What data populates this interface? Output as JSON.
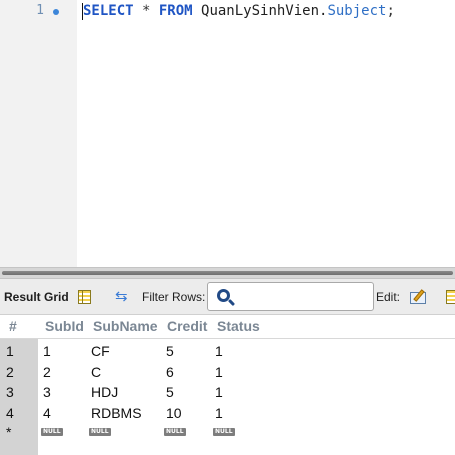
{
  "editor": {
    "line_number": "1",
    "code": {
      "kw_select": "SELECT",
      "op_star": " * ",
      "kw_from": "FROM",
      "object_name": " QuanLySinhVien.",
      "field_name": "Subject",
      "terminator": ";"
    }
  },
  "toolbar": {
    "result_grid_label": "Result Grid",
    "filter_rows_label": "Filter Rows:",
    "filter_value": "",
    "edit_label": "Edit:"
  },
  "grid": {
    "columns": [
      "#",
      "SubId",
      "SubName",
      "Credit",
      "Status"
    ],
    "rows": [
      [
        "1",
        "1",
        "CF",
        "5",
        "1"
      ],
      [
        "2",
        "2",
        "C",
        "6",
        "1"
      ],
      [
        "3",
        "3",
        "HDJ",
        "5",
        "1"
      ],
      [
        "4",
        "4",
        "RDBMS",
        "10",
        "1"
      ]
    ],
    "new_row_marker": "*",
    "null_label": "NULL"
  },
  "colors": {
    "keyword": "#1f55c4",
    "field": "#2f6fc5",
    "row_header": "#d3d3d3",
    "null_tag": "#7d7d7d"
  }
}
